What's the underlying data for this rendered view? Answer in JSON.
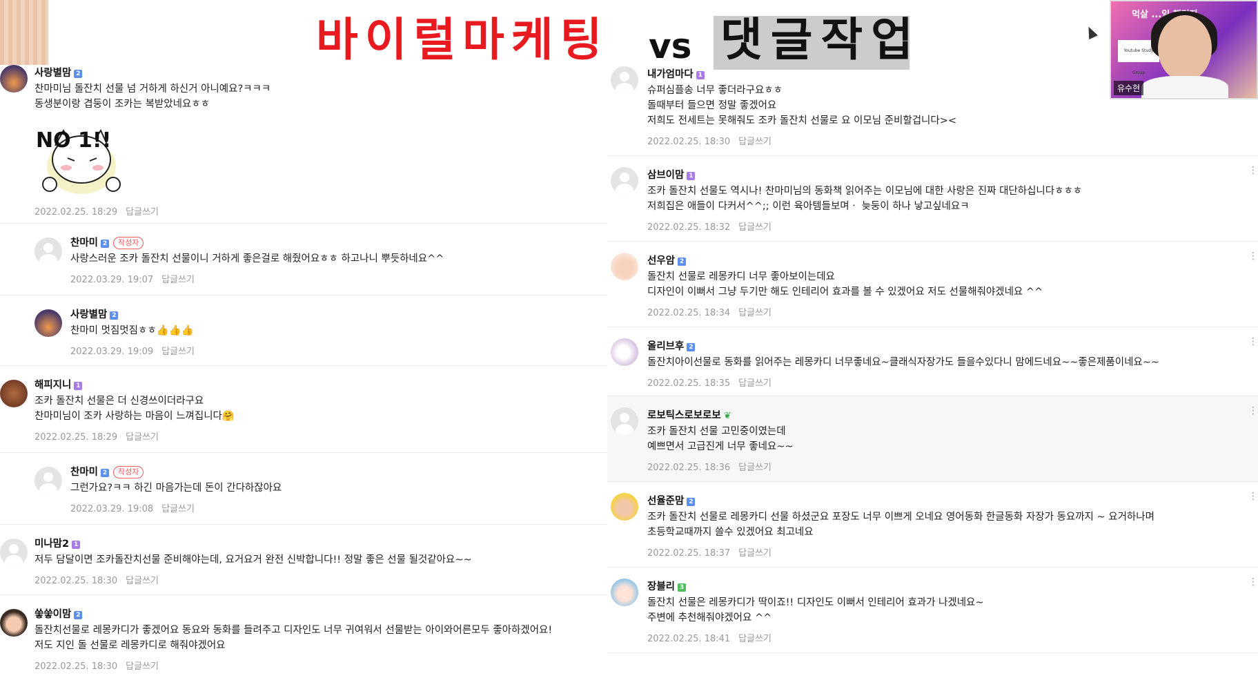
{
  "banner": {
    "red_text": "바이럴마케팅",
    "vs_text": "vs",
    "dark_text": "댓글작업"
  },
  "webcam": {
    "title": "먹살 ...일 챌린지",
    "card_text": "Youtube Study Group",
    "name": "유수현"
  },
  "reply_label": "답글쓰기",
  "author_badge": "작성자",
  "sticker_text": "NO 1!!",
  "left_comments": [
    {
      "nick": "사랑별맘",
      "level": "2",
      "lines": [
        "찬마미님 돌잔치 선물 넘 거하게 하신거 아니예요?ㅋㅋㅋ",
        "동생분이랑 겹둥이 조카는 복받았네요ㅎㅎ"
      ],
      "date": "2022.02.25. 18:29"
    },
    {
      "nick": "찬마미",
      "level": "2",
      "lines": [
        "사랑스러운 조카 돌잔치 선물이니 거하게 좋은걸로 해줬어요ㅎㅎ 하고나니 뿌듯하네요^^"
      ],
      "date": "2022.03.29. 19:07"
    },
    {
      "nick": "사랑별맘",
      "level": "2",
      "lines": [
        "찬마미 멋짐멋짐ㅎㅎ👍👍👍"
      ],
      "date": "2022.03.29. 19:09"
    },
    {
      "nick": "해피지니",
      "level": "1",
      "lines": [
        "조카 돌잔치 선물은 더 신경쓰이더라구요",
        "찬마미님이 조카 사랑하는 마음이 느껴집니다🤗"
      ],
      "date": "2022.02.25. 18:29"
    },
    {
      "nick": "찬마미",
      "level": "2",
      "lines": [
        "그런가요?ㅋㅋ 하긴 마음가는데 돈이 간다하잖아요"
      ],
      "date": "2022.03.29. 19:08"
    },
    {
      "nick": "미나맘2",
      "level": "1",
      "lines": [
        "저두 담달이면 조카돌잔치선물 준비해야는데, 요거요거 완전 신박합니다!! 정말 좋은 선물 될것같아요~~"
      ],
      "date": "2022.02.25. 18:30"
    },
    {
      "nick": "쑿쑿이맘",
      "level": "2",
      "lines": [
        "돌잔치선물로 레몽카디가 좋겠어요 동요와 동화를 들려주고 디자인도 너무 귀여워서 선물받는 아이와어른모두 좋아하겠어요!",
        "저도 지인 돌 선물로 레몽카디로 해줘야겠어요"
      ],
      "date": "2022.02.25. 18:30"
    }
  ],
  "right_comments": [
    {
      "nick": "내가엄마다",
      "level": "1",
      "lines": [
        "슈퍼심플송 너무 좋더라구요ㅎㅎ",
        "돌때부터 들으면 정말 좋겠어요",
        "저희도 전세트는 못해줘도 조카 돌잔치 선물로 요 이모님 준비할겁니다><"
      ],
      "date": "2022.02.25. 18:30"
    },
    {
      "nick": "삼브이맘",
      "level": "1",
      "lines": [
        "조카 돌잔치 선물도 역시나! 찬마미님의 동화책 읽어주는 이모님에 대한 사랑은 진짜 대단하십니다ㅎㅎㅎ",
        "저희집은 애들이 다커서^^;; 이런 육아템들보며ㆍ 늦둥이 하나 낳고싶네요ㅋ"
      ],
      "date": "2022.02.25. 18:32"
    },
    {
      "nick": "선우암",
      "level": "2",
      "lines": [
        "돌잔치 선물로 레몽카디 너무 좋아보이는데요",
        "디자인이 이뻐서 그냥 두기만 해도 인테리어 효과를 볼 수 있겠어요 저도 선물해줘야겠네요 ^^"
      ],
      "date": "2022.02.25. 18:34"
    },
    {
      "nick": "올리브후",
      "level": "2",
      "lines": [
        "돌잔치아이선물로 동화를 읽어주는 레몽카디 너무좋네요~클래식자장가도  들을수있다니 맘에드네요~~좋은제품이네요~~"
      ],
      "date": "2022.02.25. 18:35"
    },
    {
      "nick": "로보틱스로보로보",
      "level": "",
      "lines": [
        "조카 돌잔치 선물 고민중이였는데",
        "예쁘면서 고급진게 너무 좋네요~~"
      ],
      "date": "2022.02.25. 18:36"
    },
    {
      "nick": "선율준맘",
      "level": "2",
      "lines": [
        "조카 돌잔치 선물로 레몽카디 선물 하셨군요 포장도 너무 이쁘게 오네요 영어동화 한글동화 자장가 동요까지 ~ 요거하나며",
        "초등학교때까지 쓸수 있겠어요 최고네요"
      ],
      "date": "2022.02.25. 18:37"
    },
    {
      "nick": "장블리",
      "level": "3",
      "lines": [
        "돌잔치 선물은 레몽카디가 딱이죠!! 디자인도 이뻐서 인테리어 효과가 나겠네요~",
        "주변에 추천해줘야겠어요 ^^"
      ],
      "date": "2022.02.25. 18:41"
    }
  ]
}
